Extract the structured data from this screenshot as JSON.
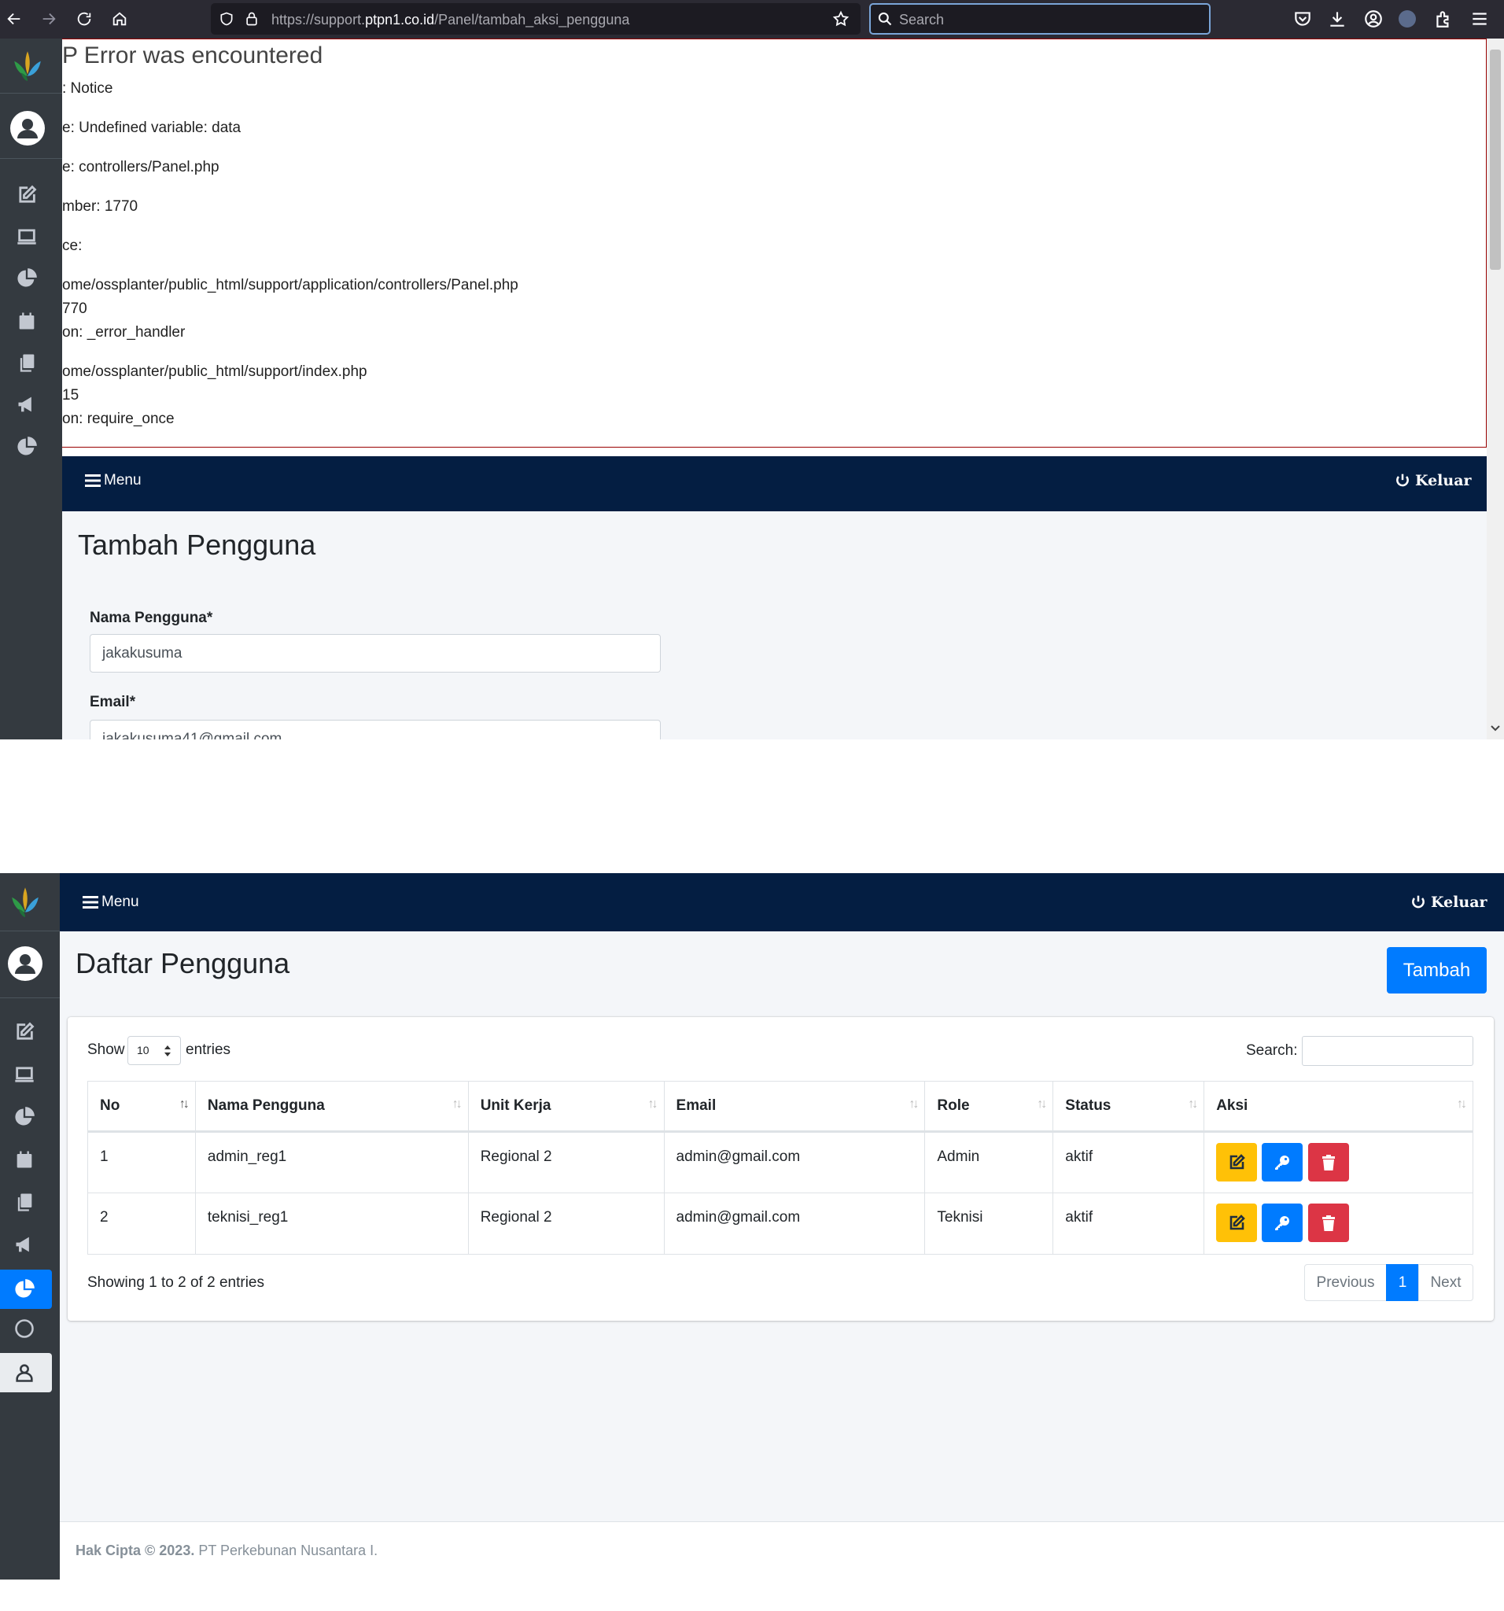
{
  "browser": {
    "url_prefix": "https://support.",
    "url_host": "ptpn1.co.id",
    "url_path": "/Panel/tambah_aksi_pengguna",
    "search_placeholder": "Search"
  },
  "error": {
    "title": "P Error was encountered",
    "lines": [
      ": Notice",
      "e: Undefined variable: data",
      "e: controllers/Panel.php",
      "mber: 1770",
      "ce:",
      "ome/ossplanter/public_html/support/application/controllers/Panel.php",
      "770",
      "on: _error_handler",
      "ome/ossplanter/public_html/support/index.php",
      "15",
      "on: require_once"
    ]
  },
  "navbar": {
    "menu_label": "Menu",
    "logout_label": "Keluar"
  },
  "form_page": {
    "title": "Tambah Pengguna",
    "fields": [
      {
        "label": "Nama Pengguna*",
        "value": "jakakusuma"
      },
      {
        "label": "Email*",
        "value": "jakakusuma41@gmail.com"
      }
    ]
  },
  "list_page": {
    "title": "Daftar Pengguna",
    "add_button": "Tambah",
    "show_label": "Show",
    "entries_label": "entries",
    "page_length": "10",
    "search_label": "Search:",
    "columns": [
      "No",
      "Nama Pengguna",
      "Unit Kerja",
      "Email",
      "Role",
      "Status",
      "Aksi"
    ],
    "rows": [
      {
        "no": "1",
        "nama": "admin_reg1",
        "unit": "Regional 2",
        "email": "admin@gmail.com",
        "role": "Admin",
        "status": "aktif"
      },
      {
        "no": "2",
        "nama": "teknisi_reg1",
        "unit": "Regional 2",
        "email": "admin@gmail.com",
        "role": "Teknisi",
        "status": "aktif"
      }
    ],
    "info": "Showing 1 to 2 of 2 entries",
    "pagination": {
      "previous": "Previous",
      "current": "1",
      "next": "Next"
    }
  },
  "footer": {
    "bold": "Hak Cipta © 2023.",
    "text": " PT Perkebunan Nusantara I."
  },
  "colors": {
    "navbar": "#041e42",
    "sidebar": "#343a40",
    "primary": "#007bff",
    "warning": "#ffc107",
    "danger": "#dc3545"
  }
}
